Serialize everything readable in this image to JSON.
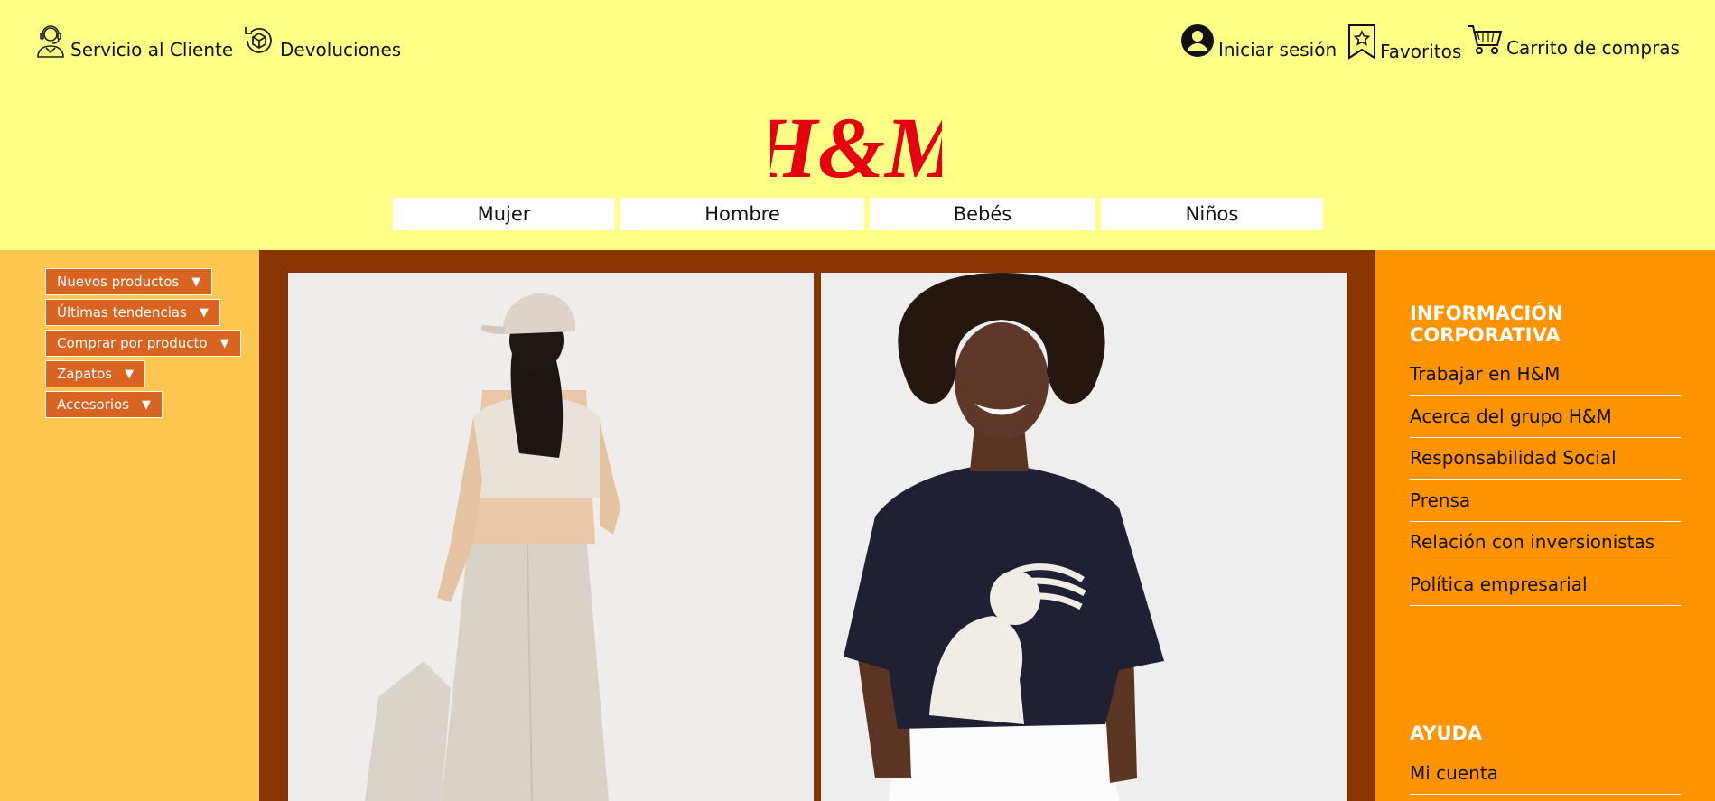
{
  "header": {
    "left_links": [
      {
        "label": "Servicio al Cliente",
        "icon": "customer-service-icon"
      },
      {
        "label": "Devoluciones",
        "icon": "returns-icon"
      }
    ],
    "right_links": [
      {
        "label": "Iniciar sesión",
        "icon": "user-icon"
      },
      {
        "label": "Favoritos",
        "icon": "favorites-bookmark-icon"
      },
      {
        "label": "Carrito de compras",
        "icon": "cart-icon"
      }
    ],
    "logo_text": "H&M",
    "logo_color": "#e50010",
    "nav": [
      "Mujer",
      "Hombre",
      "Bebés",
      "Niños"
    ]
  },
  "sidebar": {
    "categories": [
      {
        "label": "Nuevos productos",
        "arrow": "▼"
      },
      {
        "label": "Últimas tendencias",
        "arrow": "▼"
      },
      {
        "label": "Comprar por producto",
        "arrow": "▼"
      },
      {
        "label": "Zapatos",
        "arrow": "▼"
      },
      {
        "label": "Accesorios",
        "arrow": "▼"
      }
    ]
  },
  "main": {
    "images": [
      {
        "alt": "model-in-beige-outfit-and-cap"
      },
      {
        "alt": "model-in-navy-graphic-tshirt"
      }
    ]
  },
  "right_panel": {
    "corporate": {
      "title": "INFORMACIÓN CORPORATIVA",
      "links": [
        "Trabajar en H&M",
        "Acerca del grupo H&M",
        "Responsabilidad Social",
        "Prensa",
        "Relación con inversionistas",
        "Política empresarial"
      ]
    },
    "help": {
      "title": "AYUDA",
      "links": [
        "Mi cuenta"
      ]
    }
  },
  "colors": {
    "header_bg": "#ffff88",
    "left_bg": "#ffc750",
    "center_bg": "#8a3400",
    "right_bg": "#ff9400",
    "category_bg": "#d96421"
  }
}
